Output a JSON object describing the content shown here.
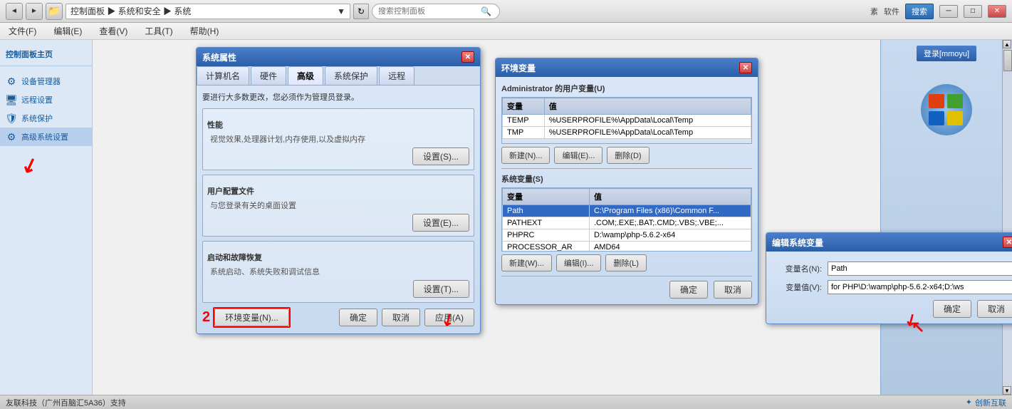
{
  "topbar": {
    "back_btn": "◄",
    "forward_btn": "►",
    "breadcrumb": "控制面板 ▶ 系统和安全 ▶ 系统",
    "refresh_label": "↻",
    "search_placeholder": "搜索控制面板",
    "search_icon": "🔍",
    "minimize_label": "─",
    "maximize_label": "□",
    "close_label": "✕",
    "right_label": "素",
    "software_label": "软件",
    "search_btn": "搜索"
  },
  "menubar": {
    "items": [
      "文件(F)",
      "编辑(E)",
      "查看(V)",
      "工具(T)",
      "帮助(H)"
    ]
  },
  "sidebar": {
    "title": "控制面板主页",
    "items": [
      {
        "id": "device-manager",
        "label": "设备管理器",
        "icon": "⚙"
      },
      {
        "id": "remote",
        "label": "远程设置",
        "icon": "🖥"
      },
      {
        "id": "system-protect",
        "label": "系统保护",
        "icon": "🛡"
      },
      {
        "id": "advanced",
        "label": "高级系统设置",
        "icon": "⚙",
        "active": true
      }
    ]
  },
  "sysprop_dialog": {
    "title": "系统属性",
    "tabs": [
      "计算机名",
      "硬件",
      "高级",
      "系统保护",
      "远程"
    ],
    "active_tab": "高级",
    "performance_label": "性能",
    "performance_text": "视觉效果,处理器计划,内存使用,以及虚拟内存",
    "performance_btn": "设置(S)...",
    "user_profiles_label": "用户配置文件",
    "user_profiles_text": "与您登录有关的桌面设置",
    "user_profiles_btn": "设置(E)...",
    "startup_label": "启动和故障恢复",
    "startup_text": "系统启动、系统失败和调试信息",
    "startup_btn": "设置(T)...",
    "env_btn": "环境变量(N)...",
    "ok_btn": "确定",
    "cancel_btn": "取消",
    "apply_btn": "应用(A)",
    "require_admin": "要进行大多数更改，您必须作为管理员登录。"
  },
  "envvar_dialog": {
    "title": "环境变量",
    "user_section": "Administrator 的用户变量(U)",
    "user_vars": [
      {
        "name": "TEMP",
        "value": "%USERPROFILE%\\AppData\\Local\\Temp"
      },
      {
        "name": "TMP",
        "value": "%USERPROFILE%\\AppData\\Local\\Temp"
      }
    ],
    "system_section": "系统变量(S)",
    "system_vars": [
      {
        "name": "Path",
        "value": "C:\\Program Files (x86)\\Common F..."
      },
      {
        "name": "PATHEXT",
        "value": ".COM;.EXE;.BAT;.CMD;.VBS;.VBE;..."
      },
      {
        "name": "PHPRC",
        "value": "D:\\wamp\\php-5.6.2-x64"
      },
      {
        "name": "PROCESSOR_AR",
        "value": "AMD64"
      }
    ],
    "new_btn_user": "新建(N)...",
    "edit_btn_user": "编辑(E)...",
    "delete_btn_user": "删除(D)",
    "new_btn_sys": "新建(W)...",
    "edit_btn_sys": "编辑(I)...",
    "delete_btn_sys": "删除(L)",
    "ok_btn": "确定",
    "cancel_btn": "取消",
    "close_icon": "✕"
  },
  "editsysvar_dialog": {
    "title": "编辑系统变量",
    "var_name_label": "变量名(N):",
    "var_name_value": "Path",
    "var_value_label": "变量值(V):",
    "var_value_value": "for PHP\\D:\\wamp\\php-5.6.2-x64;D:\\ws",
    "ok_btn": "确定",
    "cancel_btn": "取消",
    "close_icon": "✕"
  },
  "rightpanel": {
    "user_badge": "登录[mmoyu]",
    "scroll_up": "▲",
    "scroll_down": "▼"
  },
  "statusbar": {
    "text": "友联科技（广州百脑汇5A36）支持",
    "logo": "✦创新互联"
  },
  "annotations": {
    "num2": "2",
    "arrow1": "↗",
    "arrow2": "↗"
  }
}
